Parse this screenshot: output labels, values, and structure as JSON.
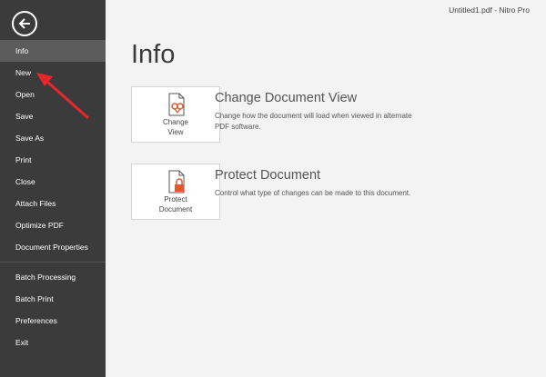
{
  "window": {
    "title": "Untitled1.pdf - Nitro Pro"
  },
  "sidebar": {
    "items": [
      {
        "label": "Info"
      },
      {
        "label": "New"
      },
      {
        "label": "Open"
      },
      {
        "label": "Save"
      },
      {
        "label": "Save As"
      },
      {
        "label": "Print"
      },
      {
        "label": "Close"
      },
      {
        "label": "Attach Files"
      },
      {
        "label": "Optimize PDF"
      },
      {
        "label": "Document Properties"
      },
      {
        "label": "Batch Processing"
      },
      {
        "label": "Batch Print"
      },
      {
        "label": "Preferences"
      },
      {
        "label": "Exit"
      }
    ]
  },
  "main": {
    "title": "Info",
    "sections": [
      {
        "button_line1": "Change",
        "button_line2": "View",
        "title": "Change Document View",
        "description": "Change how the document will load when viewed in alternate PDF software."
      },
      {
        "button_line1": "Protect",
        "button_line2": "Document",
        "title": "Protect Document",
        "description": "Control what type of changes can be made to this document."
      }
    ]
  },
  "colors": {
    "sidebar": "#3b3b3b",
    "active_item": "#5c5c5c",
    "accent": "#e05a2b",
    "annotation_arrow": "#e8262c"
  }
}
